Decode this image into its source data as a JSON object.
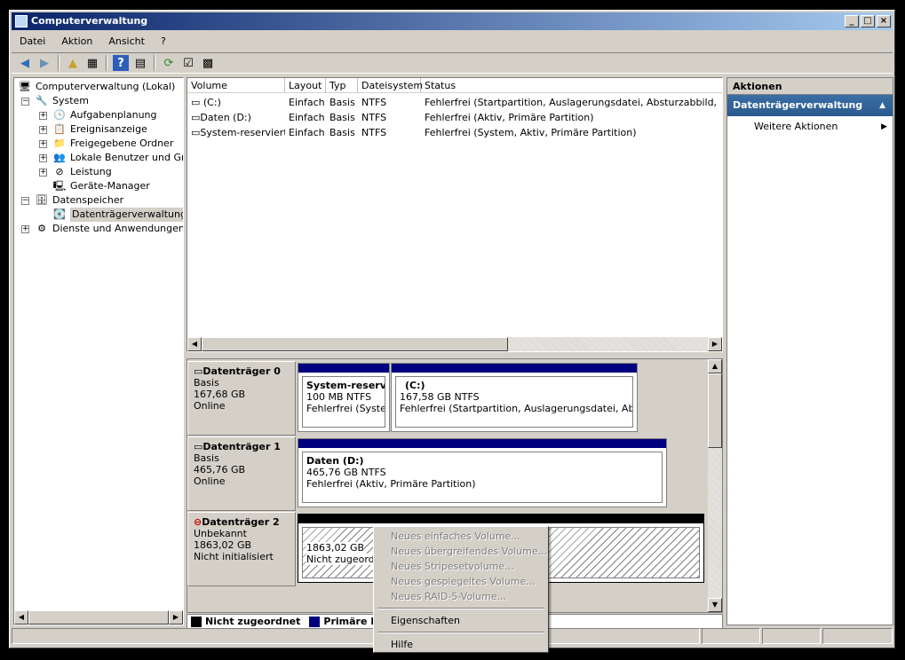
{
  "window": {
    "title": "Computerverwaltung",
    "min": "_",
    "max": "□",
    "close": "×"
  },
  "menu": [
    "Datei",
    "Aktion",
    "Ansicht",
    "?"
  ],
  "tree": {
    "root": "Computerverwaltung (Lokal)",
    "system": "System",
    "aufgaben": "Aufgabenplanung",
    "ereignis": "Ereignisanzeige",
    "freigabe": "Freigegebene Ordner",
    "benutzer": "Lokale Benutzer und Grupp",
    "leistung": "Leistung",
    "geraete": "Geräte-Manager",
    "speicher": "Datenspeicher",
    "datentraeger": "Datenträgerverwaltung",
    "dienste": "Dienste und Anwendungen"
  },
  "list": {
    "headers": [
      "Volume",
      "Layout",
      "Typ",
      "Dateisystem",
      "Status"
    ],
    "rows": [
      [
        "(C:)",
        "Einfach",
        "Basis",
        "NTFS",
        "Fehlerfrei (Startpartition, Auslagerungsdatei, Absturzabbild, Primäre P"
      ],
      [
        "Daten (D:)",
        "Einfach",
        "Basis",
        "NTFS",
        "Fehlerfrei (Aktiv, Primäre Partition)"
      ],
      [
        "System-reserviert",
        "Einfach",
        "Basis",
        "NTFS",
        "Fehlerfrei (System, Aktiv, Primäre Partition)"
      ]
    ]
  },
  "disks": [
    {
      "name": "Datenträger 0",
      "type": "Basis",
      "size": "167,68 GB",
      "state": "Online"
    },
    {
      "name": "Datenträger 1",
      "type": "Basis",
      "size": "465,76 GB",
      "state": "Online"
    },
    {
      "name": "Datenträger 2",
      "type": "Unbekannt",
      "size": "1863,02 GB",
      "state": "Nicht initialisiert"
    }
  ],
  "parts": {
    "sysres": {
      "name": "System-reservi",
      "size": "100 MB NTFS",
      "status": "Fehlerfrei (System,"
    },
    "c": {
      "name": "(C:)",
      "size": "167,58 GB NTFS",
      "status": "Fehlerfrei (Startpartition, Auslagerungsdatei, Absturza"
    },
    "d": {
      "name": "Daten  (D:)",
      "size": "465,76 GB NTFS",
      "status": "Fehlerfrei (Aktiv, Primäre Partition)"
    },
    "unalloc": {
      "size": "1863,02 GB",
      "status": "Nicht zugeordnet"
    }
  },
  "legend": {
    "unalloc": "Nicht zugeordnet",
    "primary": "Primäre Part"
  },
  "actions": {
    "header": "Aktionen",
    "section": "Datenträgerverwaltung",
    "more": "Weitere Aktionen"
  },
  "context": {
    "disabled": [
      "Neues einfaches Volume...",
      "Neues übergreifendes Volume...",
      "Neues Stripesetvolume...",
      "Neues gespiegeltes Volume...",
      "Neues RAID-5-Volume..."
    ],
    "props": "Eigenschaften",
    "help": "Hilfe"
  }
}
